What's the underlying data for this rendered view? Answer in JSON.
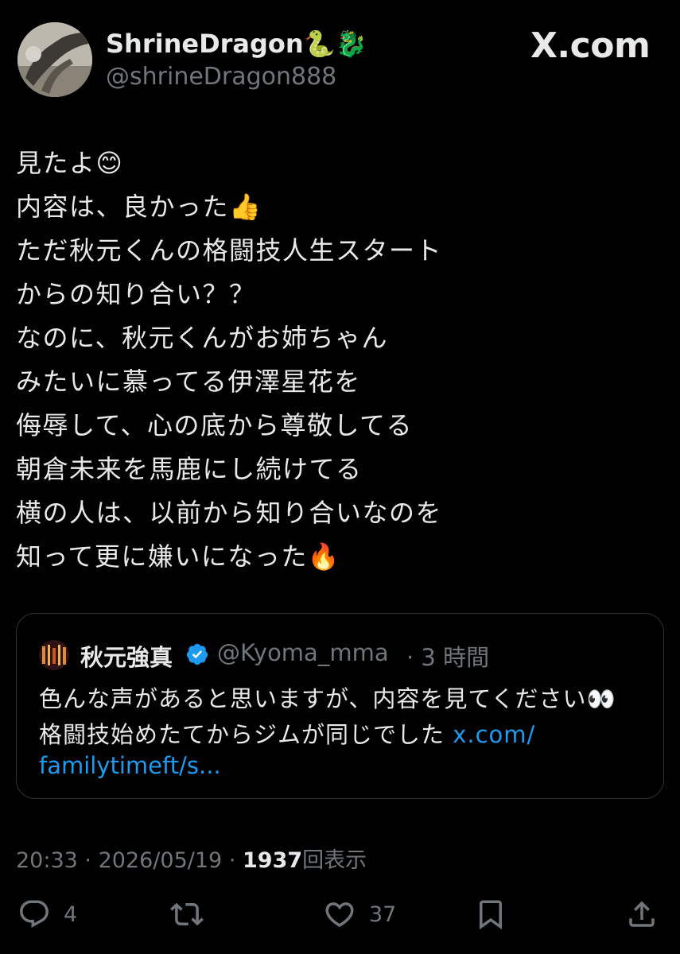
{
  "header": {
    "display_name": "ShrineDragon🐍🐉",
    "handle": "@shrineDragon888",
    "site_logo": "X.com"
  },
  "tweet": {
    "lines": [
      "見たよ😊",
      "内容は、良かった👍",
      "ただ秋元くんの格闘技人生スタート",
      "からの知り合い？？",
      "なのに、秋元くんがお姉ちゃん",
      "みたいに慕ってる伊澤星花を",
      "侮辱して、心の底から尊敬してる",
      "朝倉未来を馬鹿にし続けてる",
      "横の人は、以前から知り合いなのを",
      "知って更に嫌いになった🔥"
    ]
  },
  "quote": {
    "name": "秋元強真",
    "handle": "@Kyoma_mma",
    "time": "· 3 時間",
    "line1": "色んな声があると思いますが、内容を見てください👀",
    "line2_text": "格闘技始めたてからジムが同じでした ",
    "line2_link": "x.com/",
    "line3_link": "familytimeft/s..."
  },
  "meta": {
    "time": "20:33",
    "separator": "·",
    "date": "2026/05/19",
    "views_count": "1937",
    "views_label": "回表示"
  },
  "actions": {
    "replies": "4",
    "likes": "37"
  },
  "colors": {
    "background": "#000000",
    "text": "#e7e9ea",
    "muted": "#71767b",
    "link": "#1d9bf0",
    "verified": "#1d9bf0",
    "border": "#2f3336"
  },
  "icons": [
    "avatar-photo",
    "x-logo-icon",
    "verified-badge-icon",
    "reply-icon",
    "retweet-icon",
    "like-icon",
    "bookmark-icon",
    "share-icon"
  ]
}
